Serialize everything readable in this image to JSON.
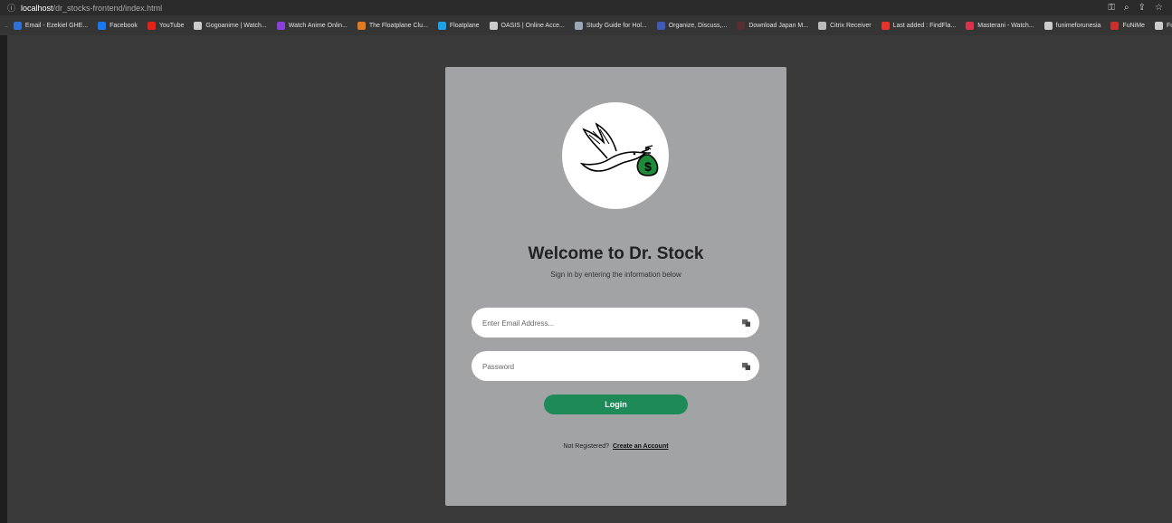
{
  "browser": {
    "url_host": "localhost",
    "url_path": "/dr_stocks-frontend/index.html",
    "bookmarks": [
      {
        "label": "Email - Ezekiel GHE...",
        "color": "#2f6fd6"
      },
      {
        "label": "Facebook",
        "color": "#1877f2"
      },
      {
        "label": "YouTube",
        "color": "#e62117"
      },
      {
        "label": "Gogoanime | Watch...",
        "color": "#cccccc"
      },
      {
        "label": "Watch Anime Onlin...",
        "color": "#8b3fd9"
      },
      {
        "label": "The Floatplane Clu...",
        "color": "#e07a1f"
      },
      {
        "label": "Floatplane",
        "color": "#1aa3e8"
      },
      {
        "label": "OASIS | Online Acce...",
        "color": "#cccccc"
      },
      {
        "label": "Study Guide for Hol...",
        "color": "#9aa7b5"
      },
      {
        "label": "Organize, Discuss,...",
        "color": "#3e5bb7"
      },
      {
        "label": "Download Japan M...",
        "color": "#5a2e2e"
      },
      {
        "label": "Citrix Receiver",
        "color": "#bbbbbb"
      },
      {
        "label": "Last added : FindFla...",
        "color": "#e5352b"
      },
      {
        "label": "Masterani - Watch...",
        "color": "#d8324f"
      },
      {
        "label": "funimeforunesia",
        "color": "#cccccc"
      },
      {
        "label": "FuNiMe",
        "color": "#c9302c"
      },
      {
        "label": "Fu",
        "color": "#cccccc"
      }
    ]
  },
  "login": {
    "title": "Welcome to Dr. Stock",
    "subtitle": "Sign in by entering the information below",
    "email_placeholder": "Enter Email Address...",
    "password_placeholder": "Password",
    "login_label": "Login",
    "not_registered": "Not Registered?",
    "create_account": "Create an Account"
  },
  "colors": {
    "card": "#a2a3a5",
    "login_button": "#1e8a57",
    "page_bg": "#3a3a3a"
  }
}
